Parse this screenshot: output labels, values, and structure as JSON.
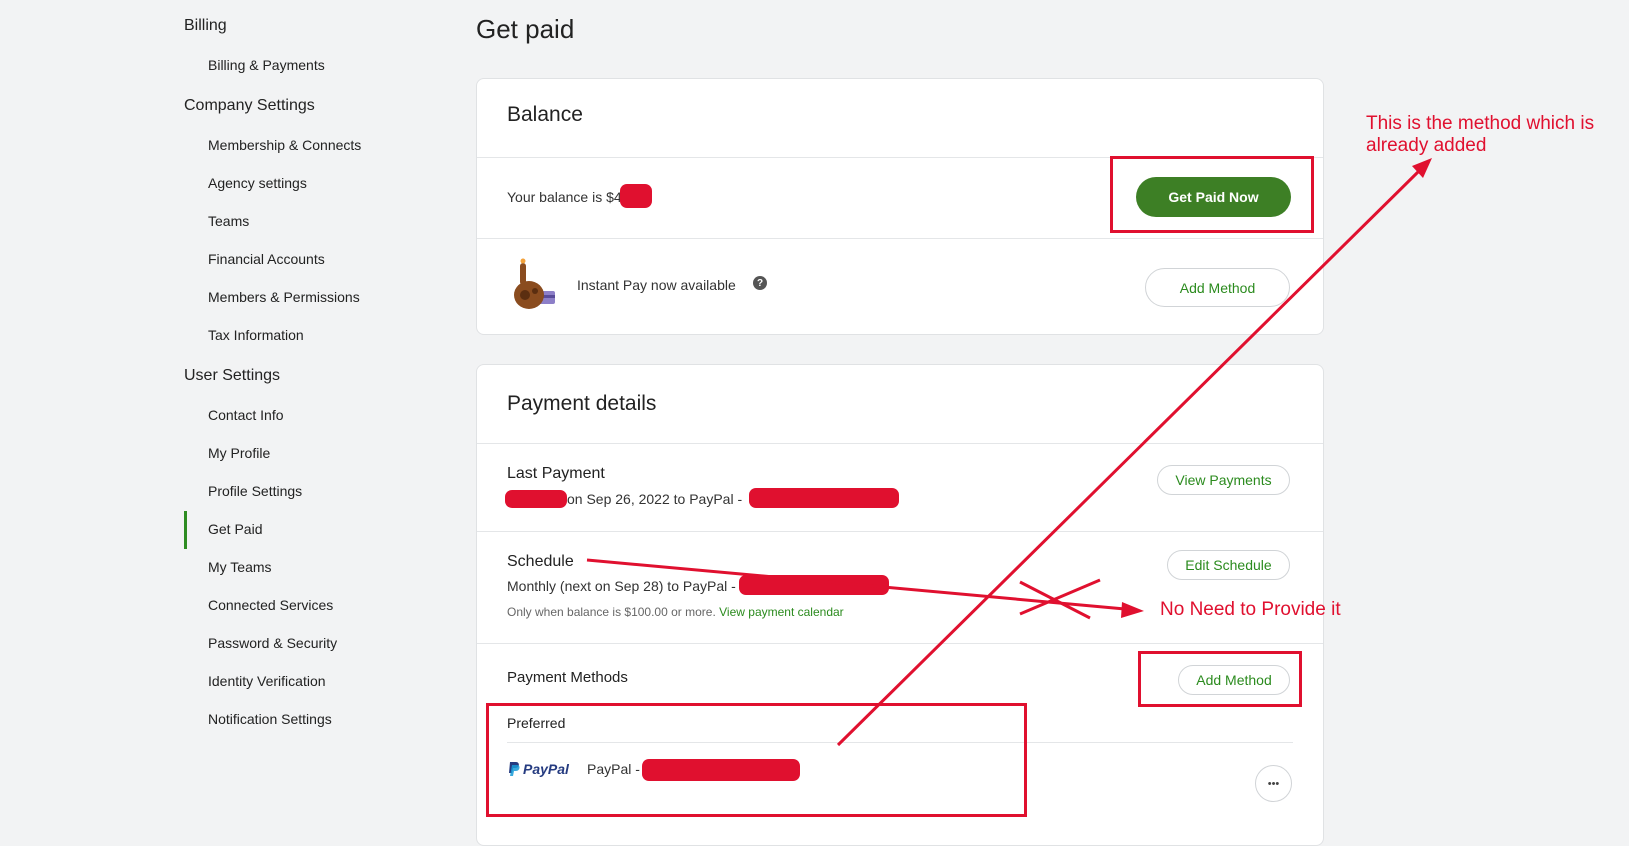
{
  "sidebar": {
    "billing": {
      "title": "Billing",
      "items": [
        "Billing & Payments"
      ]
    },
    "company": {
      "title": "Company Settings",
      "items": [
        "Membership & Connects",
        "Agency settings",
        "Teams",
        "Financial Accounts",
        "Members & Permissions",
        "Tax Information"
      ]
    },
    "user": {
      "title": "User Settings",
      "items": [
        "Contact Info",
        "My Profile",
        "Profile Settings",
        "Get Paid",
        "My Teams",
        "Connected Services",
        "Password & Security",
        "Identity Verification",
        "Notification Settings"
      ]
    },
    "active_item": "Get Paid",
    "accent_color": "#2e8c22"
  },
  "page": {
    "title": "Get paid"
  },
  "balance": {
    "title": "Balance",
    "balance_text": "Your balance is $4",
    "get_paid_button": "Get Paid Now",
    "instant_pay_text": "Instant Pay now available",
    "help_icon": "?",
    "add_method_button": "Add Method"
  },
  "payment_details": {
    "title": "Payment details",
    "last_payment": {
      "label": "Last Payment",
      "detail": "on Sep 26, 2022 to PayPal -",
      "button": "View Payments"
    },
    "schedule": {
      "label": "Schedule",
      "detail": "Monthly (next on Sep 28) to PayPal -",
      "note": "Only when balance is $100.00 or more.",
      "calendar_link": "View payment calendar",
      "button": "Edit Schedule"
    },
    "methods": {
      "label": "Payment Methods",
      "add_button": "Add Method",
      "preferred_label": "Preferred",
      "paypal_logo": "PayPal",
      "paypal_text": "PayPal -",
      "more_icon": "•••"
    }
  },
  "annotations": {
    "already_added": "This is the method which is already added",
    "no_need": "No Need to Provide it",
    "color": "#e0102f"
  }
}
